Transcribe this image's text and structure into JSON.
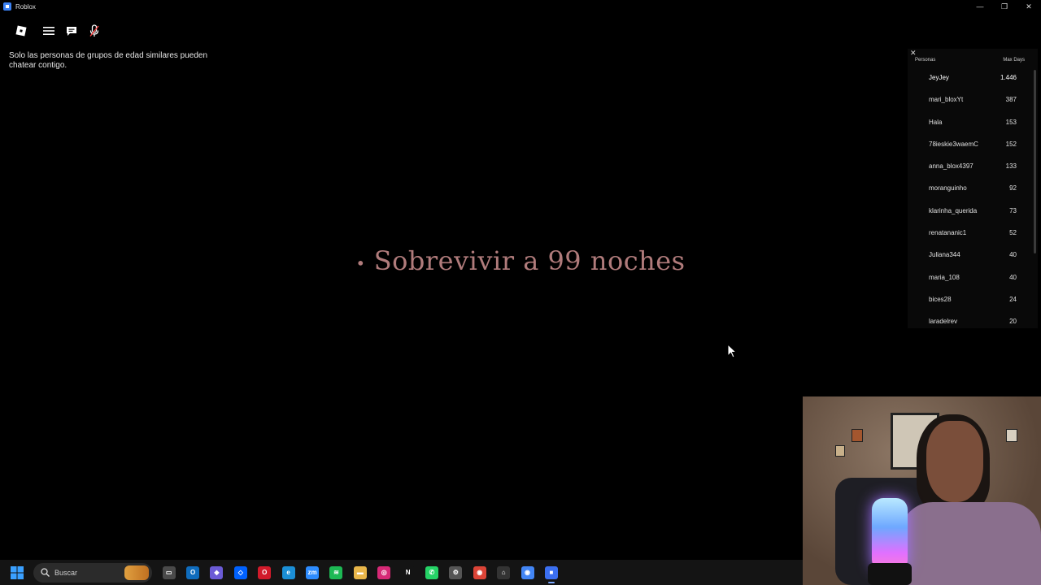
{
  "window": {
    "title": "Roblox",
    "controls": {
      "minimize": "—",
      "maximize": "❐",
      "close": "✕"
    }
  },
  "topbar": {
    "icons": [
      "roblox-logo-icon",
      "menu-icon",
      "chat-icon",
      "microphone-icon"
    ]
  },
  "notice": {
    "text": "Solo las personas de grupos de edad similares pueden chatear contigo."
  },
  "center": {
    "dot": "•",
    "message": "Sobrevivir a 99 noches"
  },
  "leaderboard": {
    "close": "✕",
    "col_player": "Personas",
    "col_stat": "Max Days",
    "rows": [
      {
        "name": "JeyJey",
        "value": "1.446"
      },
      {
        "name": "mari_bloxYt",
        "value": "387"
      },
      {
        "name": "Hala",
        "value": "153"
      },
      {
        "name": "78ieskie3waemC",
        "value": "152"
      },
      {
        "name": "anna_blox4397",
        "value": "133"
      },
      {
        "name": "moranguinho",
        "value": "92"
      },
      {
        "name": "klarinha_querida",
        "value": "73"
      },
      {
        "name": "renatananic1",
        "value": "52"
      },
      {
        "name": "Juliana344",
        "value": "40"
      },
      {
        "name": "maria_108",
        "value": "40"
      },
      {
        "name": "bices28",
        "value": "24"
      },
      {
        "name": "laradelrev",
        "value": "20"
      }
    ]
  },
  "taskbar": {
    "search_label": "Buscar",
    "apps": [
      {
        "icon": "file-explorer-icon",
        "color": "#4a4a4a",
        "glyph": "▭"
      },
      {
        "icon": "outlook-icon",
        "color": "#0f6cbd",
        "glyph": "O"
      },
      {
        "icon": "copilot-icon",
        "color": "#6b5bd6",
        "glyph": "◆"
      },
      {
        "icon": "dropbox-icon",
        "color": "#0061fe",
        "glyph": "◇"
      },
      {
        "icon": "opera-icon",
        "color": "#d11a2a",
        "glyph": "O"
      },
      {
        "icon": "edge-icon",
        "color": "#1b8fd6",
        "glyph": "e"
      },
      {
        "icon": "zoom-icon",
        "color": "#2d8cff",
        "glyph": "zm"
      },
      {
        "icon": "spotify-icon",
        "color": "#1db954",
        "glyph": "≋"
      },
      {
        "icon": "folder-icon",
        "color": "#e8b64a",
        "glyph": "▬"
      },
      {
        "icon": "instagram-icon",
        "color": "#d62976",
        "glyph": "◎"
      },
      {
        "icon": "netflix-icon",
        "color": "#141414",
        "glyph": "N"
      },
      {
        "icon": "whatsapp-icon",
        "color": "#25d366",
        "glyph": "✆"
      },
      {
        "icon": "settings-icon",
        "color": "#555555",
        "glyph": "⚙"
      },
      {
        "icon": "chrome-icon",
        "color": "#db4437",
        "glyph": "◉"
      },
      {
        "icon": "store-icon",
        "color": "#333333",
        "glyph": "⌂"
      },
      {
        "icon": "chrome-alt-icon",
        "color": "#4285f4",
        "glyph": "◉"
      },
      {
        "icon": "roblox-icon",
        "color": "#3b6ff0",
        "glyph": "■"
      }
    ],
    "active_app": "roblox-icon"
  }
}
